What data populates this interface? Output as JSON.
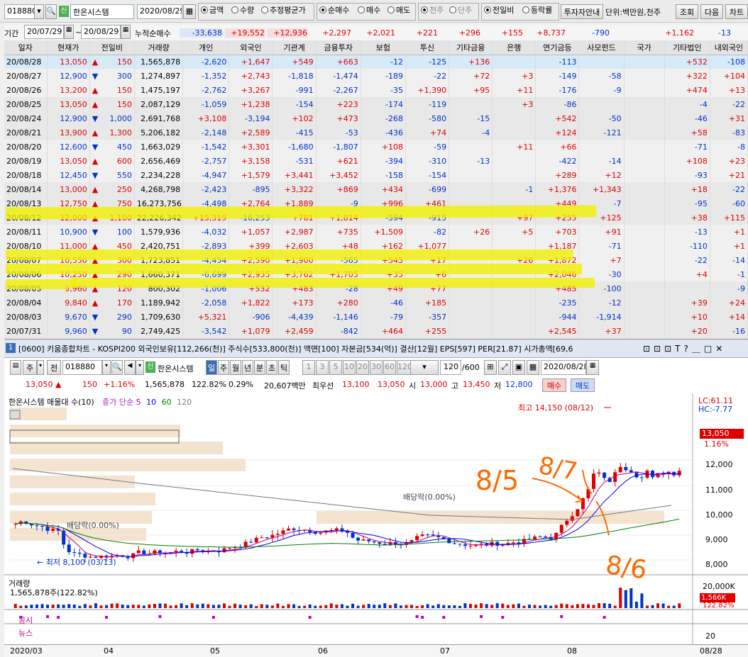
{
  "top": {
    "code": "018880",
    "badge": "신",
    "name": "한온시스템",
    "date": "2020/08/29",
    "radios1": [
      "금액",
      "수량",
      "추정평균가"
    ],
    "radios2": [
      "순매수",
      "매수",
      "매도"
    ],
    "radios3": [
      "천주",
      "단주"
    ],
    "radios4": [
      "전일비",
      "등락률"
    ],
    "btn_guide": "투자자안내",
    "unit": "단위:백만원,천주",
    "btn_query": "조회",
    "btn_next": "다음",
    "btn_chart": "차트"
  },
  "range": {
    "label": "기간",
    "from": "20/07/29",
    "sep": "~",
    "to": "20/08/29",
    "accum": "누적순매수",
    "vals": [
      "-33,638",
      "+19,552",
      "+12,936",
      "+2,297",
      "+2,021",
      "+221",
      "+296",
      "+155",
      "+8,737",
      "-790",
      "",
      "+1,162",
      "-13"
    ]
  },
  "headers": [
    "일자",
    "현재가",
    "전일비",
    "거래량",
    "개인",
    "외국인",
    "기관계",
    "금융투자",
    "보험",
    "투신",
    "기타금융",
    "은행",
    "연기금등",
    "사모펀드",
    "국가",
    "기타법인",
    "내외국인"
  ],
  "rows": [
    [
      "20/08/28",
      "13,050",
      "up",
      "150",
      "1,565,878",
      "-2,620",
      "+1,647",
      "+549",
      "+663",
      "-12",
      "-125",
      "+136",
      "",
      "-113",
      "",
      "",
      "+532",
      "-108"
    ],
    [
      "20/08/27",
      "12,900",
      "dn",
      "300",
      "1,274,897",
      "-1,352",
      "+2,743",
      "-1,818",
      "-1,474",
      "-189",
      "-22",
      "+72",
      "+3",
      "-149",
      "-58",
      "",
      "+322",
      "+104"
    ],
    [
      "20/08/26",
      "13,200",
      "up",
      "150",
      "1,475,197",
      "-2,762",
      "+3,267",
      "-991",
      "-2,267",
      "-35",
      "+1,390",
      "+95",
      "+11",
      "-176",
      "-9",
      "",
      "+474",
      "+13"
    ],
    [
      "20/08/25",
      "13,050",
      "up",
      "150",
      "2,087,129",
      "-1,059",
      "+1,238",
      "-154",
      "+223",
      "-174",
      "-119",
      "",
      "+3",
      "-86",
      "",
      "",
      "-4",
      "-22"
    ],
    [
      "20/08/24",
      "12,900",
      "dn",
      "1,000",
      "2,691,768",
      "+3,108",
      "-3,194",
      "+102",
      "+473",
      "-268",
      "-580",
      "-15",
      "",
      "+542",
      "-50",
      "",
      "-46",
      "+31"
    ],
    [
      "20/08/21",
      "13,900",
      "up",
      "1,300",
      "5,206,182",
      "-2,148",
      "+2,589",
      "-415",
      "-53",
      "-436",
      "+74",
      "-4",
      "",
      "+124",
      "-121",
      "",
      "+58",
      "-83"
    ],
    [
      "20/08/20",
      "12,600",
      "dn",
      "450",
      "1,663,029",
      "-1,542",
      "+3,301",
      "-1,680",
      "-1,807",
      "+108",
      "-59",
      "",
      "+11",
      "+66",
      "",
      "",
      "-71",
      "-8"
    ],
    [
      "20/08/19",
      "13,050",
      "up",
      "600",
      "2,656,469",
      "-2,757",
      "+3,158",
      "-531",
      "+621",
      "-394",
      "-310",
      "-13",
      "",
      "-422",
      "-14",
      "",
      "+108",
      "+23"
    ],
    [
      "20/08/18",
      "12,450",
      "dn",
      "550",
      "2,234,228",
      "-4,947",
      "+1,579",
      "+3,441",
      "+3,452",
      "-158",
      "-154",
      "",
      "",
      "+289",
      "+12",
      "",
      "-93",
      "+21"
    ],
    [
      "20/08/14",
      "13,000",
      "up",
      "250",
      "4,268,798",
      "-2,423",
      "-895",
      "+3,322",
      "+869",
      "+434",
      "-699",
      "",
      "-1",
      "+1,376",
      "+1,343",
      "",
      "+18",
      "-22"
    ],
    [
      "20/08/13",
      "12,750",
      "up",
      "750",
      "16,273,756",
      "-4,498",
      "+2,764",
      "+1,889",
      "-9",
      "+996",
      "+461",
      "",
      "",
      "+449",
      "-7",
      "",
      "-95",
      "-60"
    ],
    [
      "20/08/12",
      "12,000",
      "up",
      "1,100",
      "22,226,342",
      "+15,319",
      "-16,253",
      "+781",
      "+1,814",
      "-594",
      "-915",
      "",
      "+97",
      "+255",
      "+125",
      "",
      "+38",
      "+115"
    ],
    [
      "20/08/11",
      "10,900",
      "dn",
      "100",
      "1,579,936",
      "-4,032",
      "+1,057",
      "+2,987",
      "+735",
      "+1,509",
      "-82",
      "+26",
      "+5",
      "+703",
      "+91",
      "",
      "-13",
      "+1"
    ],
    [
      "20/08/10",
      "11,000",
      "up",
      "450",
      "2,420,751",
      "-2,893",
      "+399",
      "+2,603",
      "+48",
      "+162",
      "+1,077",
      "",
      "",
      "+1,187",
      "-71",
      "",
      "-110",
      "+1"
    ],
    [
      "20/08/07",
      "10,550",
      "up",
      "300",
      "1,723,851",
      "-4,454",
      "+2,590",
      "+1,900",
      "-565",
      "+543",
      "+17",
      "",
      "+26",
      "+1,872",
      "+7",
      "",
      "-22",
      "-14"
    ],
    [
      "20/08/06",
      "10,250",
      "up",
      "290",
      "1,660,371",
      "-6,699",
      "+2,935",
      "+3,762",
      "+1,705",
      "+35",
      "+6",
      "",
      "",
      "+2,046",
      "-30",
      "",
      "+4",
      "-1"
    ],
    [
      "20/08/05",
      "9,960",
      "up",
      "120",
      "800,302",
      "-1,006",
      "+532",
      "+483",
      "-28",
      "+49",
      "+77",
      "",
      "",
      "+485",
      "-100",
      "",
      "",
      "-9"
    ],
    [
      "20/08/04",
      "9,840",
      "up",
      "170",
      "1,189,942",
      "-2,058",
      "+1,822",
      "+173",
      "+280",
      "-46",
      "+185",
      "",
      "",
      "-235",
      "-12",
      "",
      "+39",
      "+24"
    ],
    [
      "20/08/03",
      "9,670",
      "dn",
      "290",
      "1,709,630",
      "+5,321",
      "-906",
      "-4,439",
      "-1,146",
      "-79",
      "-357",
      "",
      "",
      "-944",
      "-1,914",
      "",
      "+10",
      "+14"
    ],
    [
      "20/07/31",
      "9,960",
      "dn",
      "90",
      "2,749,425",
      "-3,542",
      "+1,079",
      "+2,459",
      "-842",
      "+464",
      "+255",
      "",
      "",
      "+2,545",
      "+37",
      "",
      "+20",
      "-16"
    ]
  ],
  "chart": {
    "title": "[0600] 키움종합차트 - KOSPI200 외국인보유[112,266(천)] 주식수[533,800(천)] 액면[100] 자본금[534(억)] 결산[12월] EPS[597] PER[21.87] 시가총액[69,6",
    "win_num": "1",
    "tb": {
      "ju": "주",
      "jeon": "전",
      "code": "018880",
      "badge": "신",
      "name": "한온시스템",
      "periods": [
        "일",
        "주",
        "월",
        "년",
        "분",
        "초",
        "틱"
      ],
      "nums": [
        "1",
        "3",
        "5",
        "10",
        "20",
        "30",
        "60",
        "120"
      ],
      "count": "120",
      "count_total": "/600",
      "date": "2020/08/28"
    },
    "info": {
      "price": "13,050",
      "chg": "150",
      "pct": "+1.16%",
      "vol": "1,565,878",
      "volpct": "122.82%",
      "turn": "0.29%",
      "amount": "20,607백만",
      "prio": "최우선",
      "ask": "13,100",
      "bid": "13,050",
      "open_l": "시",
      "open": "13,000",
      "high_l": "고",
      "high": "13,450",
      "low_l": "저",
      "low": "12,800",
      "buy": "매수",
      "sell": "매도"
    },
    "legend": {
      "name": "한온시스템 매물대 수(10)",
      "ma": "종가 단순",
      "ma1": "5",
      "ma2": "10",
      "ma3": "60",
      "ma4": "120"
    },
    "lc": "LC:61.11",
    "hc": "HC:-7.77",
    "price_tag": "13,050",
    "pct_tag": "1.16%",
    "yaxis": [
      "12,000",
      "11,000",
      "10,000",
      "9,000",
      "8,000"
    ],
    "high_label": "최고 14,150 (08/12)",
    "low_label": "최저 8,100 (03/13)",
    "div1": "배당락(0.00%)",
    "div2": "배당락(0.00%)",
    "vol_title": "거래량",
    "vol_val": "1,565,878주(122.82%)",
    "vol_axis": "20,000K",
    "vol_tag": "1,566K",
    "vol_tag2": "122.82%",
    "gongsi": "공시",
    "news": "뉴스",
    "news_axis": "20",
    "xaxis": [
      "2020/03",
      "04",
      "05",
      "06",
      "07",
      "08",
      "08/28"
    ],
    "anno": [
      "8/5",
      "8/7",
      "8/6"
    ]
  }
}
